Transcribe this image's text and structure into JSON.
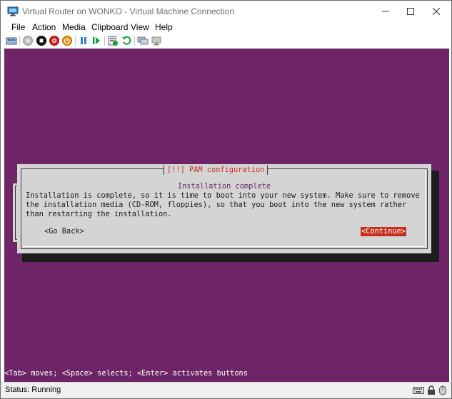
{
  "window": {
    "title": "Virtual Router on WONKO - Virtual Machine Connection"
  },
  "menu": [
    {
      "label": "File"
    },
    {
      "label": "Action"
    },
    {
      "label": "Media"
    },
    {
      "label": "Clipboard"
    },
    {
      "label": "View"
    },
    {
      "label": "Help"
    }
  ],
  "toolbar": {
    "icons": [
      "ctrl-alt-del-icon",
      "start-icon",
      "turn-off-icon",
      "shut-down-icon",
      "save-icon",
      "pause-icon",
      "reset-icon",
      "checkpoint-icon",
      "revert-icon",
      "enhanced-session-icon",
      "share-icon"
    ]
  },
  "guest": {
    "dialog": {
      "title": "[!!] PAM configuration",
      "subtitle": "Installation complete",
      "lines": [
        "Installation is complete, so it is time to boot into your new system. Make sure to remove",
        "the installation media (CD-ROM, floppies), so that you boot into the new system rather",
        "than restarting the installation."
      ],
      "go_back": "<Go Back>",
      "continue": "<Continue>"
    },
    "hint": "<Tab> moves; <Space> selects; <Enter> activates buttons"
  },
  "status": {
    "text": "Status: Running"
  },
  "colors": {
    "guest_background": "#6d2568",
    "dialog_background": "#d4d4d4",
    "accent_red": "#c6301c"
  }
}
